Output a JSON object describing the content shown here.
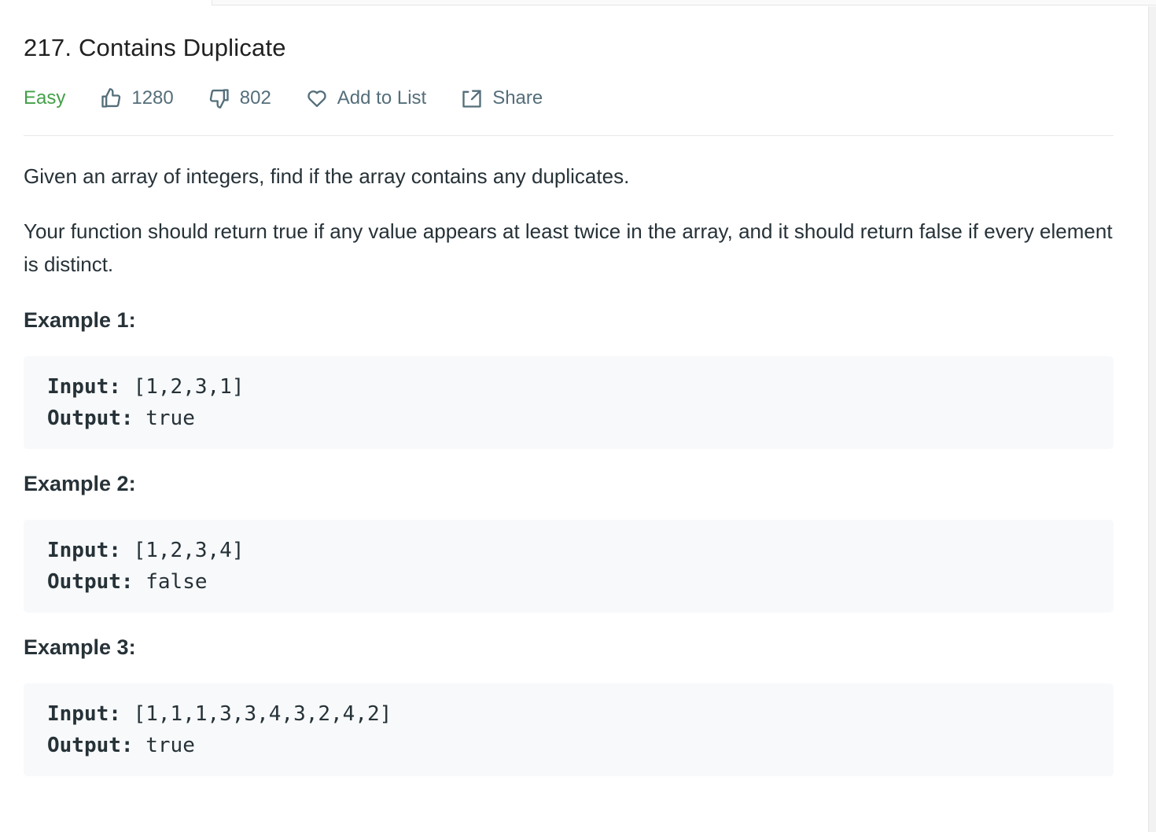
{
  "problem": {
    "title": "217. Contains Duplicate",
    "difficulty": "Easy",
    "likes": "1280",
    "dislikes": "802",
    "add_to_list_label": "Add to List",
    "share_label": "Share"
  },
  "description": {
    "paragraphs": [
      "Given an array of integers, find if the array contains any duplicates.",
      "Your function should return true if any value appears at least twice in the array, and it should return false if every element is distinct."
    ]
  },
  "examples": [
    {
      "title": "Example 1:",
      "input_label": "Input:",
      "input": "[1,2,3,1]",
      "output_label": "Output:",
      "output": "true"
    },
    {
      "title": "Example 2:",
      "input_label": "Input:",
      "input": "[1,2,3,4]",
      "output_label": "Output:",
      "output": "false"
    },
    {
      "title": "Example 3:",
      "input_label": "Input:",
      "input": "[1,1,1,3,3,4,3,2,4,2]",
      "output_label": "Output:",
      "output": "true"
    }
  ],
  "colors": {
    "difficulty_easy": "#43a047",
    "meta_text": "#546e7a",
    "code_background": "#f7f9fa"
  },
  "icons": {
    "like": "thumbs-up-icon",
    "dislike": "thumbs-down-icon",
    "add_to_list": "heart-icon",
    "share": "share-icon"
  }
}
